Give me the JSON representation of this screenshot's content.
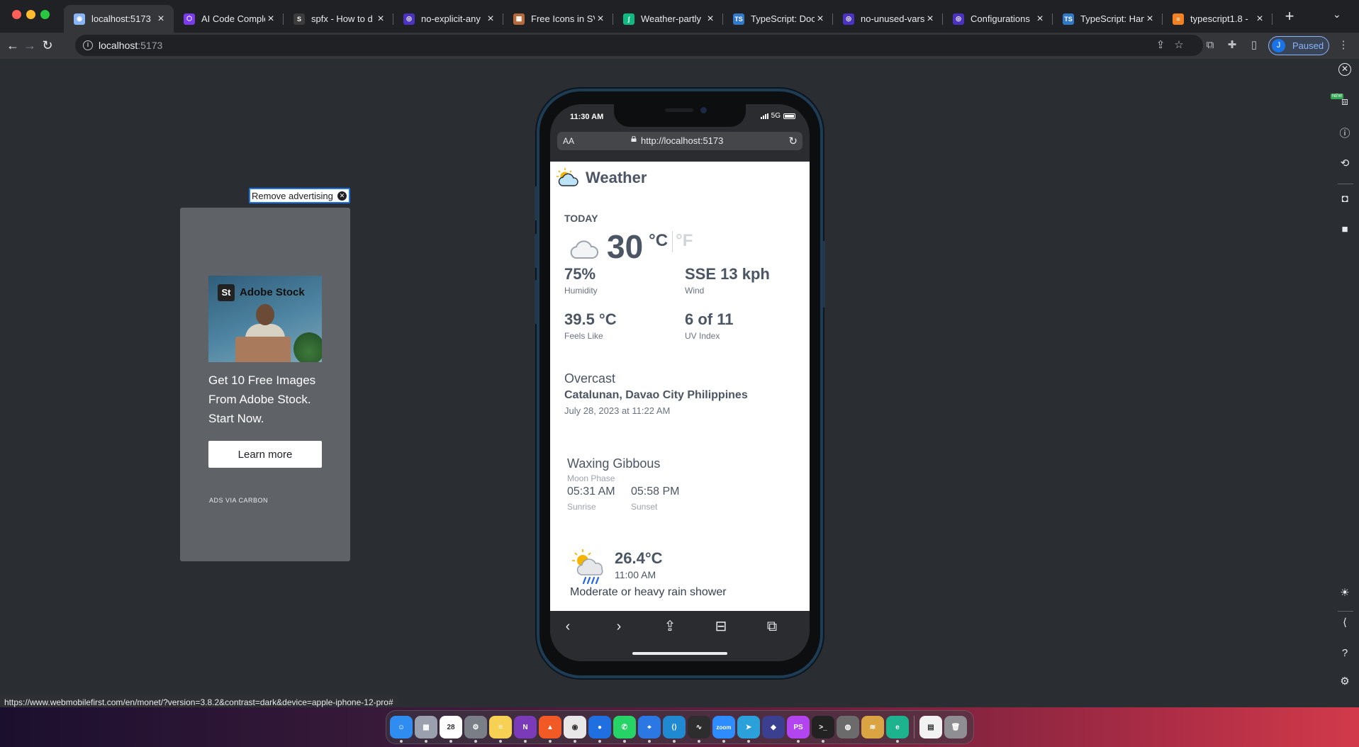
{
  "browser": {
    "tabs": [
      {
        "title": "localhost:5173",
        "fav": "#8ab4f8",
        "glyph": "◉",
        "active": true
      },
      {
        "title": "AI Code Comple",
        "fav": "#7c3aed",
        "glyph": "⬡"
      },
      {
        "title": "spfx - How to d",
        "fav": "#3c3c3c",
        "glyph": "S"
      },
      {
        "title": "no-explicit-any",
        "fav": "#4b32c3",
        "glyph": "◎"
      },
      {
        "title": "Free Icons in SV",
        "fav": "#b46a3c",
        "glyph": "▦"
      },
      {
        "title": "Weather-partly",
        "fav": "#10b981",
        "glyph": "∫"
      },
      {
        "title": "TypeScript: Doc",
        "fav": "#3178c6",
        "glyph": "TS"
      },
      {
        "title": "no-unused-vars",
        "fav": "#4b32c3",
        "glyph": "◎"
      },
      {
        "title": "Configurations",
        "fav": "#4b32c3",
        "glyph": "◎"
      },
      {
        "title": "TypeScript: Han",
        "fav": "#3178c6",
        "glyph": "TS"
      },
      {
        "title": "typescript1.8 -",
        "fav": "#f48024",
        "glyph": "≡"
      }
    ],
    "new_tab": "+",
    "address": {
      "host": "localhost",
      "port": ":5173"
    },
    "profile_initial": "J",
    "profile_status": "Paused",
    "status_url": "https://www.webmobilefirst.com/en/monet/?version=3.8.2&contrast=dark&device=apple-iphone-12-pro#"
  },
  "ad": {
    "remove_label": "Remove advertising",
    "brand_mark": "St",
    "brand_name": "Adobe Stock",
    "headline": "Get 10 Free Images From Adobe Stock. Start Now.",
    "cta": "Learn more",
    "via": "ADS VIA CARBON"
  },
  "phone": {
    "time": "11:30 AM",
    "network": "5G",
    "safari_aa": "AA",
    "safari_url": "http://localhost:5173",
    "app_title": "Weather",
    "today_label": "TODAY",
    "temperature": "30",
    "unit_c": "°C",
    "unit_f": "°F",
    "stats": {
      "humidity": {
        "value": "75%",
        "label": "Humidity"
      },
      "wind": {
        "value": "SSE 13 kph",
        "label": "Wind"
      },
      "feels_like": {
        "value": "39.5 °C",
        "label": "Feels Like"
      },
      "uv": {
        "value": "6 of 11",
        "label": "UV Index"
      }
    },
    "condition": "Overcast",
    "location": "Catalunan, Davao City Philippines",
    "date": "July 28, 2023 at 11:22 AM",
    "moon_phase": "Waxing Gibbous",
    "moon_label": "Moon Phase",
    "sunrise": "05:31 AM",
    "sunrise_label": "Sunrise",
    "sunset": "05:58 PM",
    "sunset_label": "Sunset",
    "forecast": {
      "temp": "26.4°C",
      "time": "11:00 AM",
      "desc": "Moderate or heavy rain shower"
    }
  },
  "dock": {
    "calendar_day": "28",
    "apps": [
      {
        "name": "finder",
        "color": "#2f8cf0",
        "glyph": "☺"
      },
      {
        "name": "launchpad",
        "color": "#9aa0ad",
        "glyph": "▦"
      },
      {
        "name": "calendar",
        "color": "#ffffff",
        "glyph": "28"
      },
      {
        "name": "system-preferences",
        "color": "#7a7f87",
        "glyph": "⚙"
      },
      {
        "name": "notes",
        "color": "#f7d154",
        "glyph": "≡"
      },
      {
        "name": "onenote",
        "color": "#7b3ab8",
        "glyph": "N"
      },
      {
        "name": "brave",
        "color": "#f25a25",
        "glyph": "▲"
      },
      {
        "name": "chrome",
        "color": "#e8e8e8",
        "glyph": "◉"
      },
      {
        "name": "firefox",
        "color": "#1f6fe0",
        "glyph": "●"
      },
      {
        "name": "whatsapp",
        "color": "#25d366",
        "glyph": "✆"
      },
      {
        "name": "maps",
        "color": "#2b78e4",
        "glyph": "⌖"
      },
      {
        "name": "vscode",
        "color": "#1f8ad2",
        "glyph": "⟨⟩"
      },
      {
        "name": "activity-monitor",
        "color": "#2d2d2d",
        "glyph": "∿"
      },
      {
        "name": "zoom",
        "color": "#2d8cff",
        "glyph": "zoom"
      },
      {
        "name": "telegram",
        "color": "#2aa1da",
        "glyph": "➤"
      },
      {
        "name": "layers-app",
        "color": "#3a3f8f",
        "glyph": "◆"
      },
      {
        "name": "phpstorm",
        "color": "#b345f1",
        "glyph": "PS"
      },
      {
        "name": "terminal",
        "color": "#222222",
        "glyph": ">_"
      },
      {
        "name": "disk-app",
        "color": "#6b6b6b",
        "glyph": "◍"
      },
      {
        "name": "database-app",
        "color": "#d9a441",
        "glyph": "≋"
      },
      {
        "name": "edge",
        "color": "#1db38e",
        "glyph": "e"
      },
      {
        "name": "preview",
        "color": "#f2f2f2",
        "glyph": "▤"
      },
      {
        "name": "trash",
        "color": "#8e8e93",
        "glyph": "🗑"
      }
    ]
  }
}
